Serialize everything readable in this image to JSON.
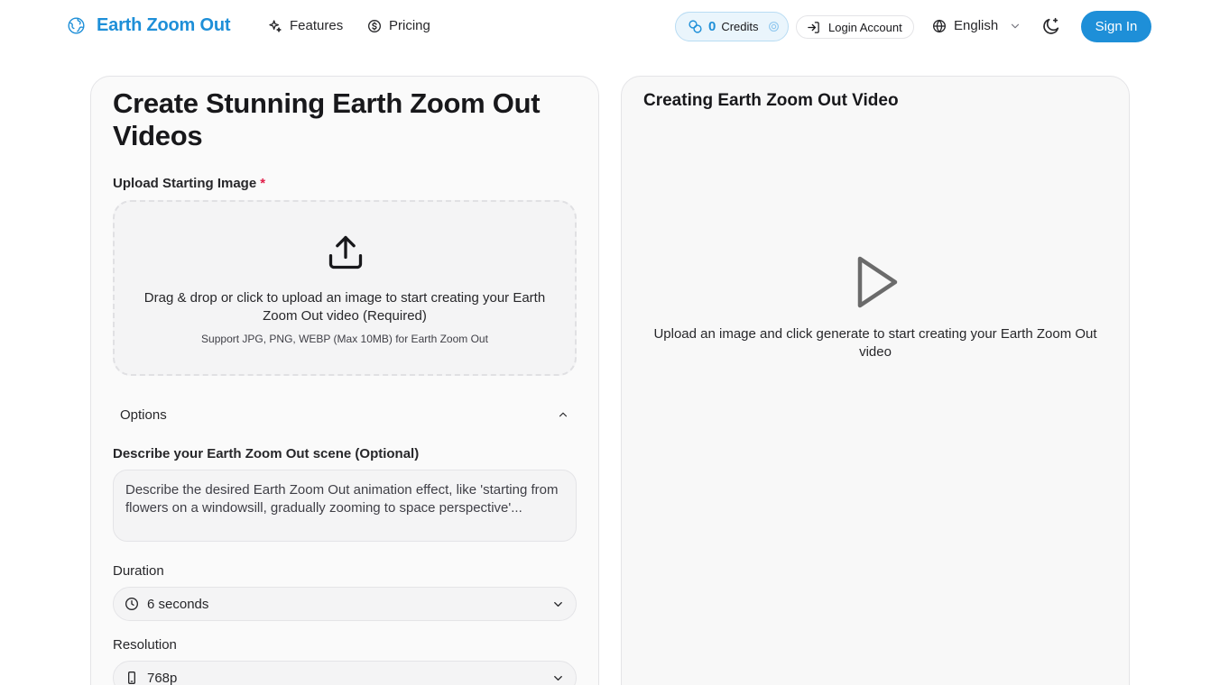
{
  "header": {
    "brand_name": "Earth Zoom Out",
    "nav": [
      {
        "label": "Features",
        "icon": "sparkles-icon"
      },
      {
        "label": "Pricing",
        "icon": "coin-icon"
      }
    ],
    "credits": {
      "count": "0",
      "label": "Credits"
    },
    "login_label": "Login Account",
    "language": "English",
    "signin_label": "Sign In",
    "accent_color": "#1e8fd8"
  },
  "left": {
    "title": "Create Stunning Earth Zoom Out Videos",
    "upload": {
      "label": "Upload Starting Image",
      "required_mark": "*",
      "main_text": "Drag & drop or click to upload an image to start creating your Earth Zoom Out video (Required)",
      "sub_text": "Support JPG, PNG, WEBP (Max 10MB) for Earth Zoom Out"
    },
    "options_label": "Options",
    "scene": {
      "label": "Describe your Earth Zoom Out scene (Optional)",
      "placeholder": "Describe the desired Earth Zoom Out animation effect, like 'starting from flowers on a windowsill, gradually zooming to space perspective'..."
    },
    "duration": {
      "label": "Duration",
      "value": "6 seconds"
    },
    "resolution": {
      "label": "Resolution",
      "value": "768p"
    }
  },
  "right": {
    "title": "Creating Earth Zoom Out Video",
    "placeholder_text": "Upload an image and click generate to start creating your Earth Zoom Out video"
  }
}
